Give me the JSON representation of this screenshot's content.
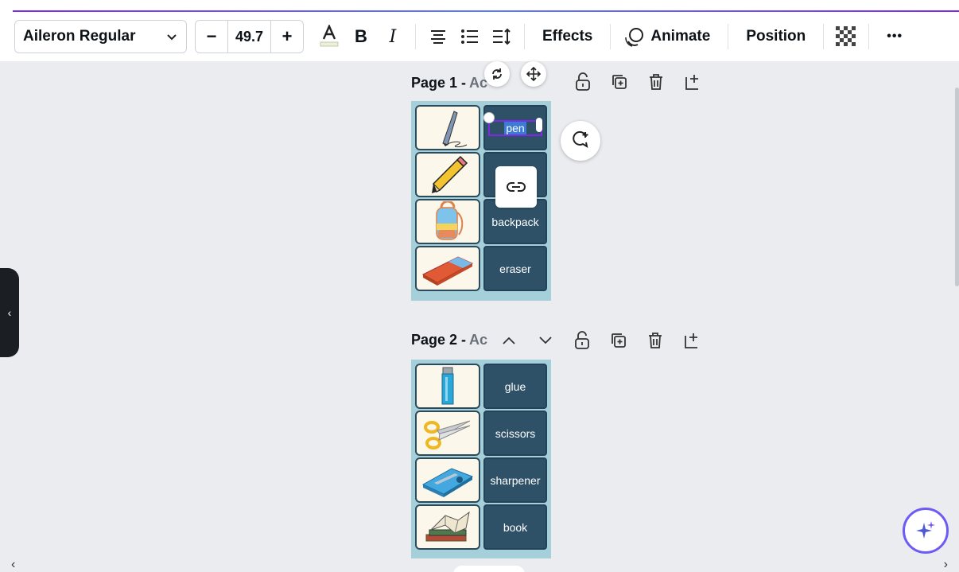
{
  "toolbar": {
    "font_name": "Aileron Regular",
    "font_size": "49.7",
    "minus_label": "−",
    "plus_label": "+",
    "effects_label": "Effects",
    "animate_label": "Animate",
    "position_label": "Position",
    "more_label": "•••"
  },
  "pages": [
    {
      "label": "Page 1 -",
      "title_placeholder": "Ac",
      "items": [
        {
          "icon": "pen-image",
          "word": "pen"
        },
        {
          "icon": "pencil-image",
          "word": ""
        },
        {
          "icon": "backpack-image",
          "word": "backpack"
        },
        {
          "icon": "eraser-image",
          "word": "eraser"
        }
      ]
    },
    {
      "label": "Page 2 -",
      "title_placeholder": "Ac",
      "items": [
        {
          "icon": "glue-image",
          "word": "glue"
        },
        {
          "icon": "scissors-image",
          "word": "scissors"
        },
        {
          "icon": "sharpener-image",
          "word": "sharpener"
        },
        {
          "icon": "book-image",
          "word": "book"
        }
      ]
    }
  ],
  "colors": {
    "accent": "#7d2ae8",
    "card_bg": "#2f5168",
    "page_bg": "#a5cfd9",
    "canvas_bg": "#ebecf0"
  }
}
